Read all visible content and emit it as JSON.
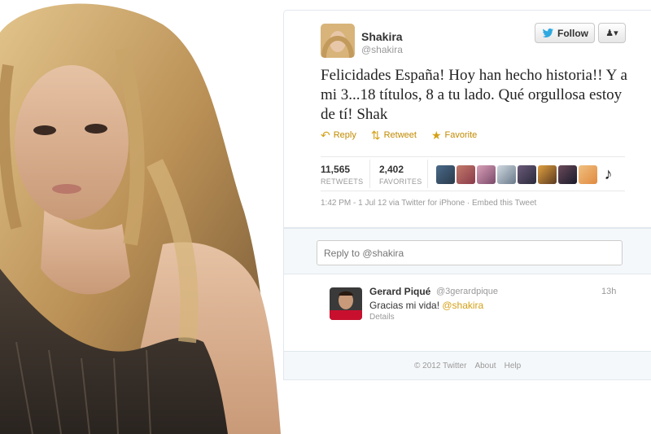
{
  "tweet": {
    "author_name": "Shakira",
    "author_handle": "@shakira",
    "follow_label": "Follow",
    "user_menu_icon": "user-dropdown-icon",
    "text": "Felicidades España! Hoy han hecho historia!! Y a mi 3...18 títulos, 8 a tu lado. Qué orgullosa estoy de tí! Shak",
    "actions": {
      "reply": "Reply",
      "retweet": "Retweet",
      "favorite": "Favorite"
    },
    "stats": {
      "retweets_count": "11,565",
      "retweets_label": "RETWEETS",
      "favorites_count": "2,402",
      "favorites_label": "FAVORITES"
    },
    "timestamp": "1:42 PM - 1 Jul 12 via Twitter for iPhone · Embed this Tweet"
  },
  "reply_box": {
    "placeholder": "Reply to @shakira"
  },
  "reply": {
    "author_name": "Gerard Piqué",
    "author_handle": "@3gerardpique",
    "time": "13h",
    "text": "Gracias mi vida! ",
    "mention": "@shakira",
    "details": "Details"
  },
  "footer": {
    "copyright": "© 2012 Twitter",
    "about": "About",
    "help": "Help"
  },
  "colors": {
    "accent": "#d4a017",
    "twitter_blue": "#2fa9e0",
    "border": "#e1e8ed",
    "muted": "#999999"
  }
}
